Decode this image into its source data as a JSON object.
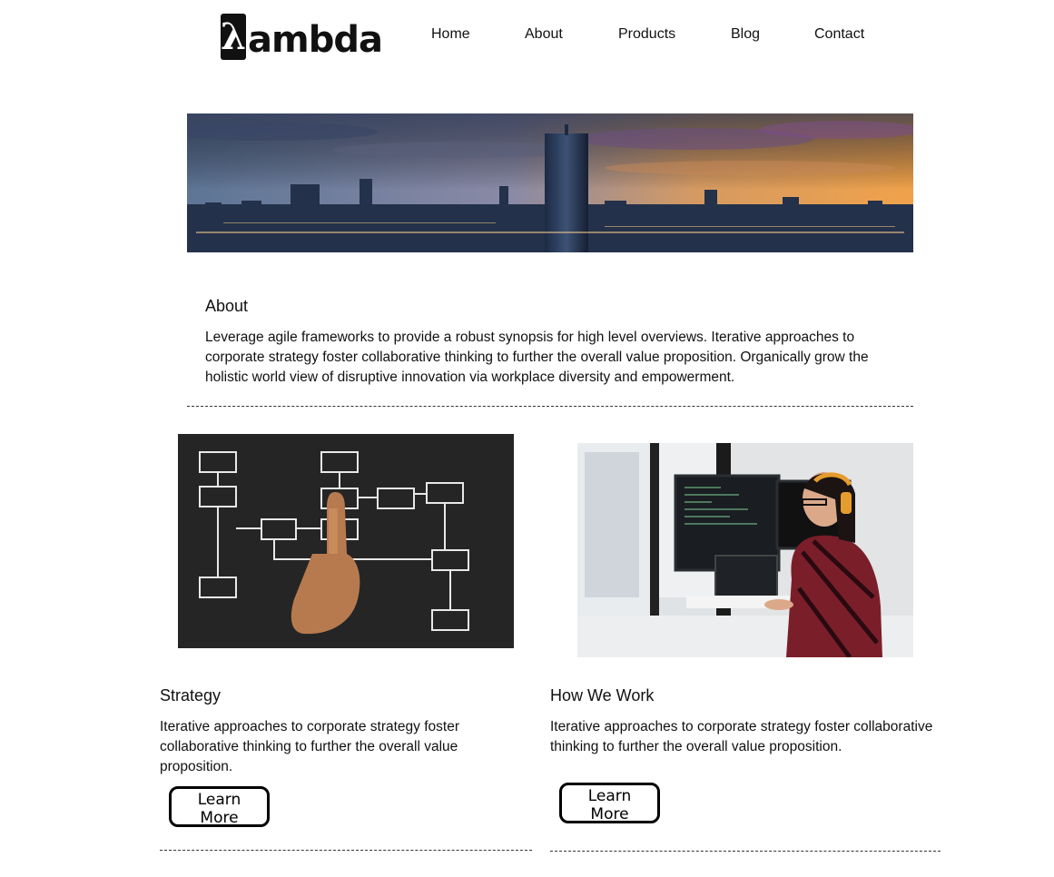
{
  "logo": {
    "mark": "λ",
    "text": "ambda"
  },
  "nav": [
    "Home",
    "About",
    "Products",
    "Blog",
    "Contact"
  ],
  "about": {
    "heading": "About",
    "text": "Leverage agile frameworks to provide a robust synopsis for high level overviews. Iterative approaches to corporate strategy foster collaborative thinking to further the overall value proposition. Organically grow the holistic world view of disruptive innovation via workplace diversity and empowerment."
  },
  "cards": [
    {
      "heading": "Strategy",
      "text": "Iterative approaches to corporate strategy foster collaborative thinking to further the overall value proposition.",
      "button": "Learn More"
    },
    {
      "heading": "How We Work",
      "text": "Iterative approaches to corporate strategy foster collaborative thinking to further the overall value proposition.",
      "button": "Learn More"
    }
  ]
}
